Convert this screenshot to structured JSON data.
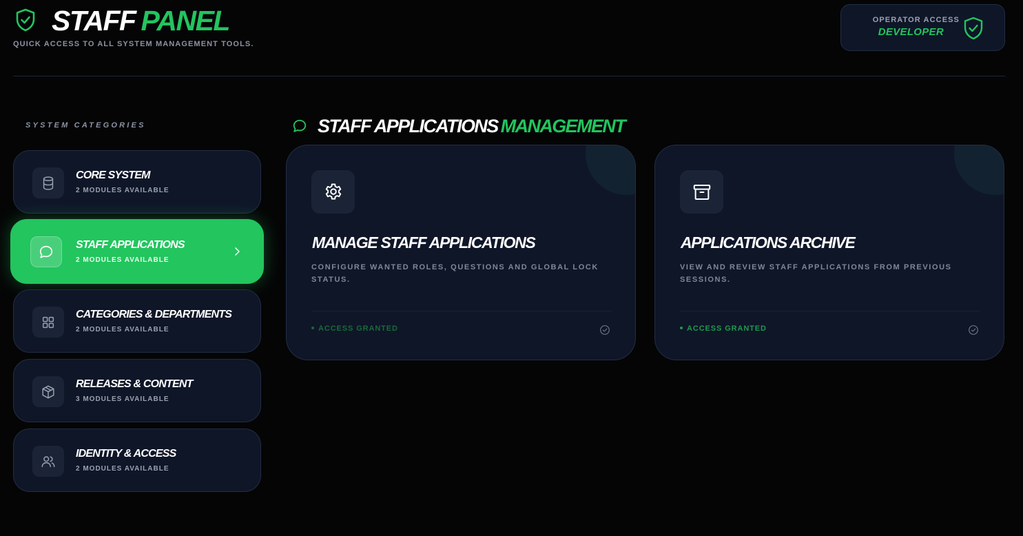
{
  "header": {
    "title_main": "STAFF",
    "title_accent": "PANEL",
    "subtitle": "QUICK ACCESS TO ALL SYSTEM MANAGEMENT TOOLS."
  },
  "operator": {
    "label": "OPERATOR ACCESS",
    "role": "DEVELOPER"
  },
  "sidebar": {
    "heading": "SYSTEM CATEGORIES",
    "items": [
      {
        "label": "CORE SYSTEM",
        "sub": "2 MODULES AVAILABLE",
        "icon": "database-icon"
      },
      {
        "label": "STAFF APPLICATIONS",
        "sub": "2 MODULES AVAILABLE",
        "icon": "chat-bubble-icon",
        "active": true
      },
      {
        "label": "CATEGORIES & DEPARTMENTS",
        "sub": "2 MODULES AVAILABLE",
        "icon": "grid-icon"
      },
      {
        "label": "RELEASES & CONTENT",
        "sub": "3 MODULES AVAILABLE",
        "icon": "package-icon"
      },
      {
        "label": "IDENTITY & ACCESS",
        "sub": "2 MODULES AVAILABLE",
        "icon": "users-icon"
      }
    ]
  },
  "section": {
    "title_main": "STAFF APPLICATIONS",
    "title_accent": "MANAGEMENT"
  },
  "cards": [
    {
      "title": "MANAGE STAFF APPLICATIONS",
      "description": "CONFIGURE WANTED ROLES, QUESTIONS AND GLOBAL LOCK STATUS.",
      "status": "ACCESS GRANTED",
      "icon": "gear-icon"
    },
    {
      "title": "APPLICATIONS ARCHIVE",
      "description": "VIEW AND REVIEW STAFF APPLICATIONS FROM PREVIOUS SESSIONS.",
      "status": "ACCESS GRANTED",
      "icon": "archive-icon"
    }
  ],
  "colors": {
    "accent": "#22c55e",
    "background": "#050506",
    "panel": "#0f1628",
    "border": "#232d42",
    "muted_text": "#8b93a3"
  }
}
